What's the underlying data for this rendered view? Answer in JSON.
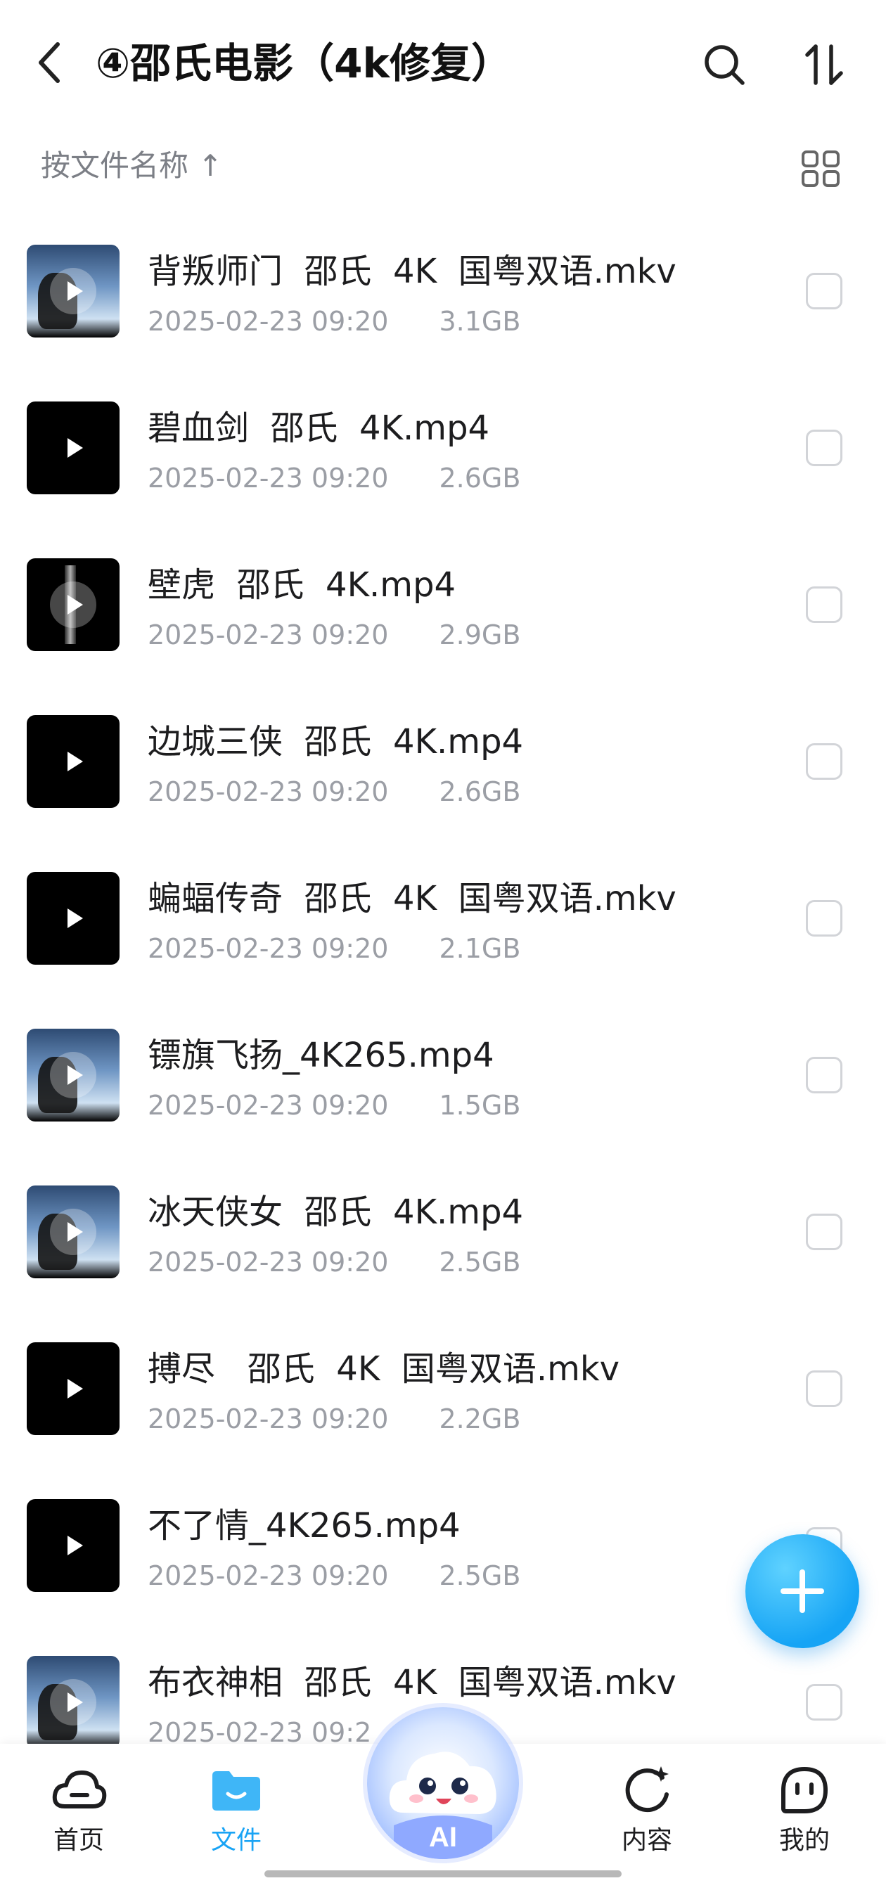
{
  "header": {
    "title": "④邵氏电影（4k修复）",
    "icons": {
      "back": "back-arrow-icon",
      "search": "search-icon",
      "sort": "sort-icon"
    }
  },
  "sort_row": {
    "label": "按文件名称 ↑",
    "icon": "grid-view-icon"
  },
  "files": [
    {
      "name": "背叛师门  邵氏  4K  国粤双语.mkv",
      "date": "2025-02-23 09:20",
      "size": "3.1GB",
      "thumb": "photo"
    },
    {
      "name": "碧血剑  邵氏  4K.mp4",
      "date": "2025-02-23 09:20",
      "size": "2.6GB",
      "thumb": "dark"
    },
    {
      "name": "壁虎  邵氏  4K.mp4",
      "date": "2025-02-23 09:20",
      "size": "2.9GB",
      "thumb": "bar"
    },
    {
      "name": "边城三侠  邵氏  4K.mp4",
      "date": "2025-02-23 09:20",
      "size": "2.6GB",
      "thumb": "dark"
    },
    {
      "name": "蝙蝠传奇  邵氏  4K  国粤双语.mkv",
      "date": "2025-02-23 09:20",
      "size": "2.1GB",
      "thumb": "dark"
    },
    {
      "name": "镖旗飞扬_4K265.mp4",
      "date": "2025-02-23 09:20",
      "size": "1.5GB",
      "thumb": "photo"
    },
    {
      "name": "冰天侠女  邵氏  4K.mp4",
      "date": "2025-02-23 09:20",
      "size": "2.5GB",
      "thumb": "photo"
    },
    {
      "name": "搏尽   邵氏  4K  国粤双语.mkv",
      "date": "2025-02-23 09:20",
      "size": "2.2GB",
      "thumb": "dark"
    },
    {
      "name": "不了情_4K265.mp4",
      "date": "2025-02-23 09:20",
      "size": "2.5GB",
      "thumb": "dark"
    },
    {
      "name": "布衣神相  邵氏  4K  国粤双语.mkv",
      "date": "2025-02-23 09:2",
      "size": "",
      "thumb": "photo"
    }
  ],
  "fab": {
    "icon": "plus-icon"
  },
  "tabs": [
    {
      "label": "首页",
      "icon": "cloud-icon",
      "active": false
    },
    {
      "label": "文件",
      "icon": "folder-icon",
      "active": true
    },
    {
      "label": "AI",
      "icon": "ai-assistant-icon",
      "active": false
    },
    {
      "label": "内容",
      "icon": "content-refresh-icon",
      "active": false
    },
    {
      "label": "我的",
      "icon": "profile-face-icon",
      "active": false
    }
  ],
  "colors": {
    "accent": "#1aa4f5",
    "meta": "#9b9ea5",
    "sort_label": "#7c7f86"
  }
}
